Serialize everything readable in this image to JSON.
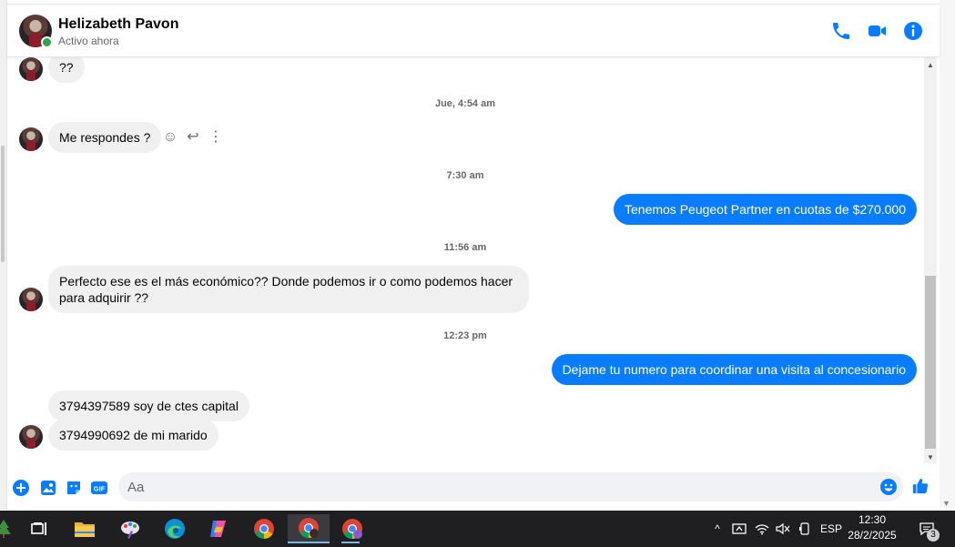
{
  "contact": {
    "name": "Helizabeth Pavon",
    "status": "Activo ahora"
  },
  "header_icons": [
    "phone-icon",
    "video-camera-icon",
    "info-icon"
  ],
  "colors": {
    "accent": "#0a7cff",
    "incoming_bubble": "#f0f0f0",
    "online": "#31a24c",
    "taskbar": "#1f1f22"
  },
  "messages": [
    {
      "side": "in",
      "text": "??"
    },
    {
      "type": "timestamp",
      "text": "Jue, 4:54 am"
    },
    {
      "side": "in",
      "text": "Me respondes ?"
    },
    {
      "type": "timestamp",
      "text": "7:30 am"
    },
    {
      "side": "out",
      "text": "Tenemos Peugeot Partner en cuotas de $270.000"
    },
    {
      "type": "timestamp",
      "text": "11:56 am"
    },
    {
      "side": "in",
      "text": "Perfecto ese es el más económico?? Donde podemos ir o como podemos hacer para adquirir ??"
    },
    {
      "type": "timestamp",
      "text": "12:23 pm"
    },
    {
      "side": "out",
      "text": "Dejame tu numero para coordinar una visita al concesionario"
    },
    {
      "side": "in",
      "text": "3794397589 soy de ctes capital"
    },
    {
      "side": "in",
      "text": "3794990692 de mi marido"
    }
  ],
  "message_actions": [
    "emoji-react-icon",
    "reply-icon",
    "more-options-icon"
  ],
  "composer": {
    "placeholder": "Aa",
    "buttons": [
      "add-icon",
      "image-icon",
      "sticker-icon",
      "gif-icon"
    ],
    "gif_label": "GIF"
  },
  "taskbar": {
    "apps": [
      "task-view-icon",
      "file-explorer-icon",
      "paint-icon",
      "edge-icon",
      "copilot-icon",
      "chrome-icon",
      "chrome-profile-icon",
      "chrome-profile-2-icon"
    ],
    "language": "ESP",
    "time": "12:30",
    "date": "28/2/2025",
    "notification_count": "3"
  }
}
